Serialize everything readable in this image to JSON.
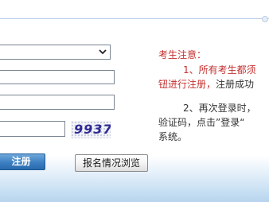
{
  "form": {
    "captcha_code": "9937",
    "register_label": "注册",
    "browse_label": "报名情况浏览",
    "select_chevron_icon": "chevron-down-icon"
  },
  "notice": {
    "title": "考生注意：",
    "item1_line1": "1、所有考生都须",
    "item1_line2_red": "钮进行注册，",
    "item1_line2_dark": "注册成功",
    "item2_line1": "2、再次登录时，",
    "item2_line2": "验证码，点击”登录“",
    "item2_line3": "系统。"
  },
  "colors": {
    "notice_red": "#c62f2f",
    "primary_button": "#3b7fc2",
    "captcha_text": "#2e2a94"
  }
}
